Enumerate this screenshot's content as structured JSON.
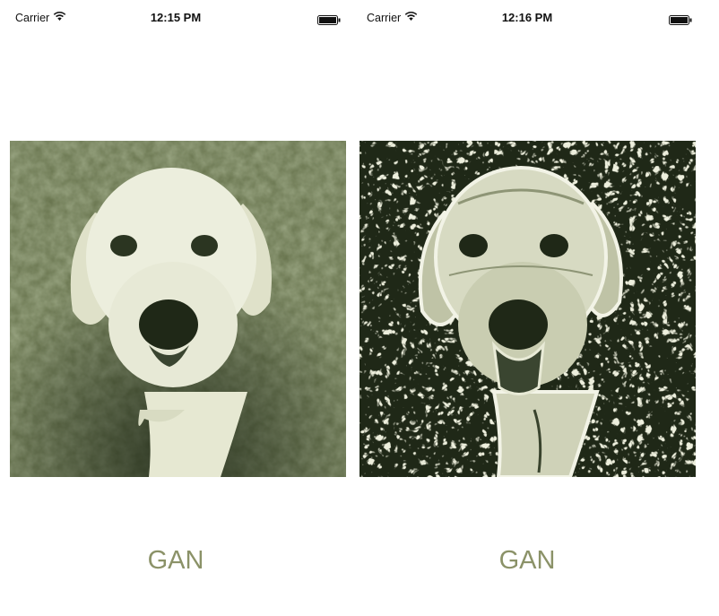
{
  "screens": [
    {
      "status": {
        "carrier": "Carrier",
        "time": "12:15 PM"
      },
      "image": {
        "subject": "labrador-puppy-photo",
        "style": "original"
      },
      "button_label": "GAN"
    },
    {
      "status": {
        "carrier": "Carrier",
        "time": "12:16 PM"
      },
      "image": {
        "subject": "labrador-puppy-photo",
        "style": "gan-stylized"
      },
      "button_label": "GAN"
    }
  ],
  "colors": {
    "tint": "#8b9268",
    "grass": "#5e6b43",
    "grass_dark": "#27331c",
    "fur": "#e8ead6",
    "nose": "#1f2817"
  }
}
